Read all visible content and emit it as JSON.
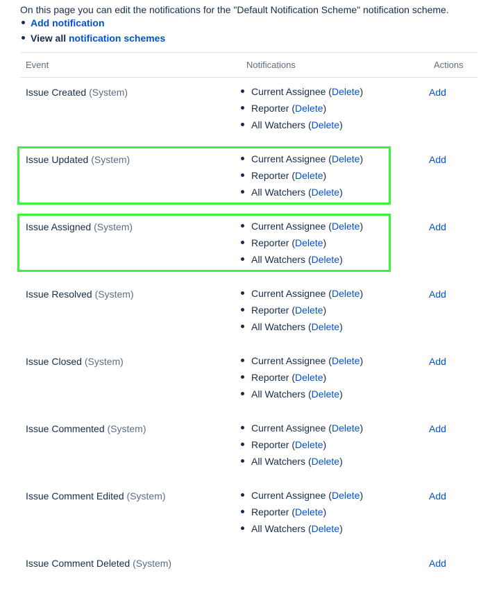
{
  "intro": "On this page you can edit the notifications for the \"Default Notification Scheme\" notification scheme.",
  "links": {
    "add_notification": "Add notification",
    "view_all_prefix": "View all ",
    "notification_schemes": "notification schemes"
  },
  "table": {
    "headers": {
      "event": "Event",
      "notifications": "Notifications",
      "actions": "Actions"
    },
    "delete_label": "Delete",
    "add_label": "Add",
    "events": [
      {
        "name": "Issue Created",
        "suffix": "(System)",
        "notifications": [
          "Current Assignee",
          "Reporter",
          "All Watchers"
        ],
        "highlighted": false
      },
      {
        "name": "Issue Updated",
        "suffix": "(System)",
        "notifications": [
          "Current Assignee",
          "Reporter",
          "All Watchers"
        ],
        "highlighted": true
      },
      {
        "name": "Issue Assigned",
        "suffix": "(System)",
        "notifications": [
          "Current Assignee",
          "Reporter",
          "All Watchers"
        ],
        "highlighted": true
      },
      {
        "name": "Issue Resolved",
        "suffix": "(System)",
        "notifications": [
          "Current Assignee",
          "Reporter",
          "All Watchers"
        ],
        "highlighted": false
      },
      {
        "name": "Issue Closed",
        "suffix": "(System)",
        "notifications": [
          "Current Assignee",
          "Reporter",
          "All Watchers"
        ],
        "highlighted": false
      },
      {
        "name": "Issue Commented",
        "suffix": "(System)",
        "notifications": [
          "Current Assignee",
          "Reporter",
          "All Watchers"
        ],
        "highlighted": false
      },
      {
        "name": "Issue Comment Edited",
        "suffix": "(System)",
        "notifications": [
          "Current Assignee",
          "Reporter",
          "All Watchers"
        ],
        "highlighted": false
      },
      {
        "name": "Issue Comment Deleted",
        "suffix": "(System)",
        "notifications": [],
        "highlighted": false
      }
    ]
  },
  "highlight_color": "#3cf33c"
}
